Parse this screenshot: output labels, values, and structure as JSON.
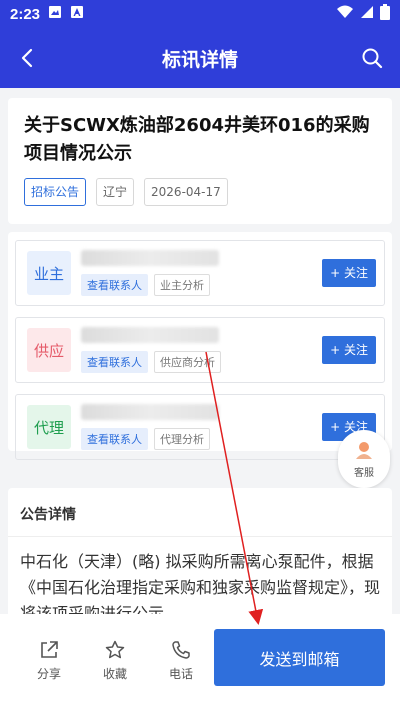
{
  "status_bar": {
    "time": "2:23"
  },
  "app_bar": {
    "title": "标讯详情"
  },
  "notice": {
    "title": "关于SCWX炼油部2604井美环016的采购项目情况公示",
    "tags": [
      "招标公告",
      "辽宁",
      "2026-04-17"
    ]
  },
  "parties": [
    {
      "badge": "业主",
      "contact_label": "查看联系人",
      "analysis_label": "业主分析",
      "follow_label": "+ 关注"
    },
    {
      "badge": "供应",
      "contact_label": "查看联系人",
      "analysis_label": "供应商分析",
      "follow_label": "+ 关注"
    },
    {
      "badge": "代理",
      "contact_label": "查看联系人",
      "analysis_label": "代理分析",
      "follow_label": "+ 关注"
    }
  ],
  "customer_service": {
    "label": "客服"
  },
  "details": {
    "heading": "公告详情",
    "body": "中石化（天津）(略) 拟采购所需离心泵配件，根据《中国石化治理指定采购和独家采购监督规定》，现将该项采购进行公示。"
  },
  "bottom_bar": {
    "share_label": "分享",
    "favorite_label": "收藏",
    "phone_label": "电话",
    "send_label": "发送到邮箱"
  },
  "colors": {
    "primary": "#2f3ed9",
    "accent": "#2f6fdc"
  }
}
